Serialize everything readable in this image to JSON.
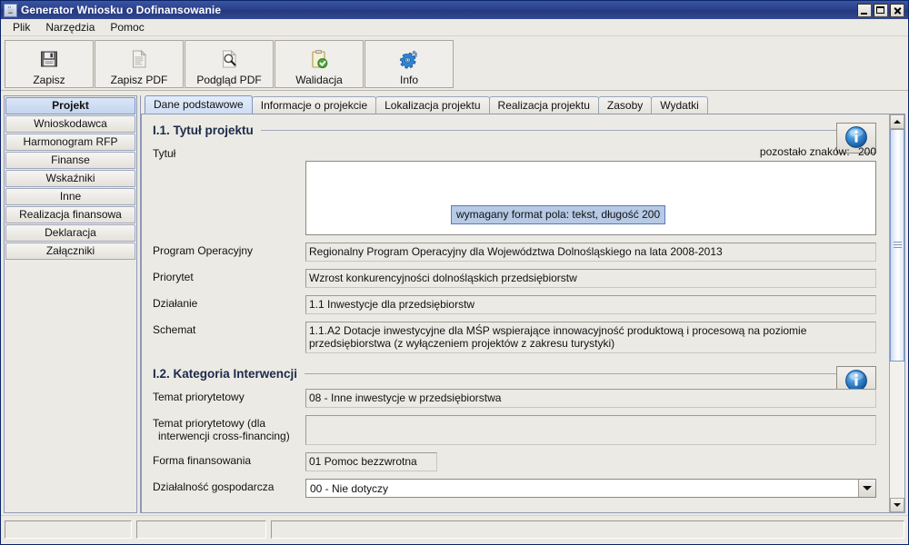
{
  "window": {
    "title": "Generator Wniosku o Dofinansowanie",
    "app_icon": "java-coffee-cup-icon",
    "controls": {
      "minimize": "minimize-icon",
      "maximize": "maximize-icon",
      "close": "close-icon"
    }
  },
  "menubar": {
    "items": [
      {
        "label": "Plik"
      },
      {
        "label": "Narzędzia"
      },
      {
        "label": "Pomoc"
      }
    ]
  },
  "toolbar": {
    "buttons": [
      {
        "label": "Zapisz",
        "icon": "floppy-disk-icon"
      },
      {
        "label": "Zapisz PDF",
        "icon": "document-page-icon"
      },
      {
        "label": "Podgląd PDF",
        "icon": "magnifier-document-icon"
      },
      {
        "label": "Walidacja",
        "icon": "clipboard-check-icon"
      },
      {
        "label": "Info",
        "icon": "gears-icon"
      }
    ]
  },
  "sidebar": {
    "items": [
      {
        "label": "Projekt",
        "selected": true
      },
      {
        "label": "Wnioskodawca",
        "selected": false
      },
      {
        "label": "Harmonogram RFP",
        "selected": false
      },
      {
        "label": "Finanse",
        "selected": false
      },
      {
        "label": "Wskaźniki",
        "selected": false
      },
      {
        "label": "Inne",
        "selected": false
      },
      {
        "label": "Realizacja finansowa",
        "selected": false
      },
      {
        "label": "Deklaracja",
        "selected": false
      },
      {
        "label": "Załączniki",
        "selected": false
      }
    ]
  },
  "tabs": [
    {
      "label": "Dane podstawowe",
      "selected": true
    },
    {
      "label": "Informacje o projekcie",
      "selected": false
    },
    {
      "label": "Lokalizacja projektu",
      "selected": false
    },
    {
      "label": "Realizacja projektu",
      "selected": false
    },
    {
      "label": "Zasoby",
      "selected": false
    },
    {
      "label": "Wydatki",
      "selected": false
    }
  ],
  "sections": {
    "s1": {
      "title": "I.1. Tytuł projektu",
      "info_icon": "info-circle-icon",
      "title_label": "Tytuł",
      "counter_text": "pozostało znaków:",
      "counter_value": "200",
      "title_value": "",
      "tooltip": "wymagany format pola: tekst, długość 200",
      "fields": [
        {
          "label": "Program Operacyjny",
          "value": "Regionalny Program Operacyjny dla Województwa Dolnośląskiego na lata 2008-2013"
        },
        {
          "label": "Priorytet",
          "value": "Wzrost konkurencyjności dolnośląskich przedsiębiorstw"
        },
        {
          "label": "Działanie",
          "value": "1.1 Inwestycje dla przedsiębiorstw"
        },
        {
          "label": "Schemat",
          "value": "1.1.A2 Dotacje inwestycyjne dla MŚP wspierające innowacyjność produktową i procesową na poziomie przedsiębiorstwa (z wyłączeniem projektów z zakresu turystyki)"
        }
      ]
    },
    "s2": {
      "title": "I.2. Kategoria Interwencji",
      "info_icon": "info-circle-icon",
      "fields": [
        {
          "label": "Temat priorytetowy",
          "value": "08 - Inne inwestycje w przedsiębiorstwa"
        },
        {
          "label_line1": "Temat priorytetowy (dla",
          "label_line2": "interwencji cross-financing)",
          "value": ""
        },
        {
          "label": "Forma finansowania",
          "value": "01 Pomoc bezzwrotna"
        }
      ],
      "combo": {
        "label": "Działalność gospodarcza",
        "value": "00 - Nie dotyczy",
        "arrow_icon": "chevron-down-icon"
      }
    }
  },
  "scrollbar": {
    "up_icon": "scroll-up-arrow-icon",
    "down_icon": "scroll-down-arrow-icon"
  },
  "statusbar": {
    "panel1": "",
    "panel2": "",
    "panel3": ""
  },
  "colors": {
    "titlebar": "#2a3f8c",
    "accent": "#7e95c4",
    "window_bg": "#eceae4",
    "tooltip_bg": "#b6c9e5",
    "info_blue": "#1f6fc4"
  }
}
